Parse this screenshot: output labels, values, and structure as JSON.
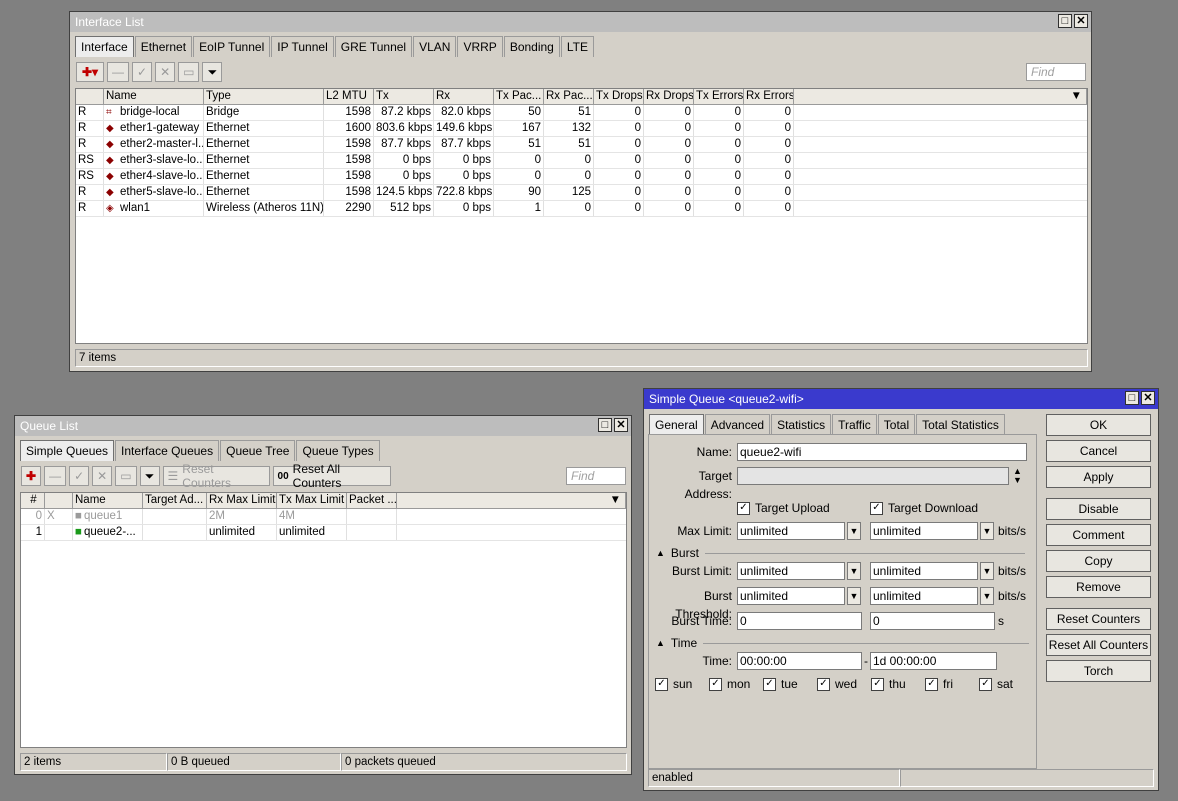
{
  "interface_list": {
    "title": "Interface List",
    "tabs": [
      "Interface",
      "Ethernet",
      "EoIP Tunnel",
      "IP Tunnel",
      "GRE Tunnel",
      "VLAN",
      "VRRP",
      "Bonding",
      "LTE"
    ],
    "find_placeholder": "Find",
    "columns": [
      "",
      "Name",
      "Type",
      "L2 MTU",
      "Tx",
      "Rx",
      "Tx Pac...",
      "Rx Pac...",
      "Tx Drops",
      "Rx Drops",
      "Tx Errors",
      "Rx Errors"
    ],
    "rows": [
      {
        "flag": "R",
        "icon": "bridge-icon",
        "name": "bridge-local",
        "type": "Bridge",
        "mtu": "1598",
        "tx": "87.2 kbps",
        "rx": "82.0 kbps",
        "txp": "50",
        "rxp": "51",
        "txd": "0",
        "rxd": "0",
        "txe": "0",
        "rxe": "0"
      },
      {
        "flag": "R",
        "icon": "ethernet-icon",
        "name": "ether1-gateway",
        "type": "Ethernet",
        "mtu": "1600",
        "tx": "803.6 kbps",
        "rx": "149.6 kbps",
        "txp": "167",
        "rxp": "132",
        "txd": "0",
        "rxd": "0",
        "txe": "0",
        "rxe": "0"
      },
      {
        "flag": "R",
        "icon": "ethernet-icon",
        "name": "ether2-master-l...",
        "type": "Ethernet",
        "mtu": "1598",
        "tx": "87.7 kbps",
        "rx": "87.7 kbps",
        "txp": "51",
        "rxp": "51",
        "txd": "0",
        "rxd": "0",
        "txe": "0",
        "rxe": "0"
      },
      {
        "flag": "RS",
        "icon": "ethernet-icon",
        "name": "ether3-slave-lo...",
        "type": "Ethernet",
        "mtu": "1598",
        "tx": "0 bps",
        "rx": "0 bps",
        "txp": "0",
        "rxp": "0",
        "txd": "0",
        "rxd": "0",
        "txe": "0",
        "rxe": "0"
      },
      {
        "flag": "RS",
        "icon": "ethernet-icon",
        "name": "ether4-slave-lo...",
        "type": "Ethernet",
        "mtu": "1598",
        "tx": "0 bps",
        "rx": "0 bps",
        "txp": "0",
        "rxp": "0",
        "txd": "0",
        "rxd": "0",
        "txe": "0",
        "rxe": "0"
      },
      {
        "flag": "R",
        "icon": "ethernet-icon",
        "name": "ether5-slave-lo...",
        "type": "Ethernet",
        "mtu": "1598",
        "tx": "124.5 kbps",
        "rx": "722.8 kbps",
        "txp": "90",
        "rxp": "125",
        "txd": "0",
        "rxd": "0",
        "txe": "0",
        "rxe": "0"
      },
      {
        "flag": "R",
        "icon": "wireless-icon",
        "name": "wlan1",
        "type": "Wireless (Atheros 11N)",
        "mtu": "2290",
        "tx": "512 bps",
        "rx": "0 bps",
        "txp": "1",
        "rxp": "0",
        "txd": "0",
        "rxd": "0",
        "txe": "0",
        "rxe": "0"
      }
    ],
    "status": "7 items"
  },
  "queue_list": {
    "title": "Queue List",
    "tabs": [
      "Simple Queues",
      "Interface Queues",
      "Queue Tree",
      "Queue Types"
    ],
    "reset_counters": "Reset Counters",
    "reset_all_counters": "Reset All Counters",
    "find_placeholder": "Find",
    "columns": [
      "#",
      "",
      "Name",
      "Target Ad...",
      "Rx Max Limit",
      "Tx Max Limit",
      "Packet ..."
    ],
    "rows": [
      {
        "num": "0",
        "flag": "X",
        "name": "queue1",
        "target": "",
        "rx": "2M",
        "tx": "4M",
        "packet": "",
        "disabled": true
      },
      {
        "num": "1",
        "flag": "",
        "name": "queue2-...",
        "target": "",
        "rx": "unlimited",
        "tx": "unlimited",
        "packet": "",
        "disabled": false
      }
    ],
    "status": [
      "2 items",
      "0 B queued",
      "0 packets queued"
    ]
  },
  "simple_queue": {
    "title": "Simple Queue <queue2-wifi>",
    "tabs": [
      "General",
      "Advanced",
      "Statistics",
      "Traffic",
      "Total",
      "Total Statistics"
    ],
    "name_label": "Name:",
    "name_value": "queue2-wifi",
    "target_label": "Target Address:",
    "target_upload": "Target Upload",
    "target_download": "Target Download",
    "max_limit_label": "Max Limit:",
    "max_limit_up": "unlimited",
    "max_limit_down": "unlimited",
    "unit_bits": "bits/s",
    "burst_section": "Burst",
    "burst_limit_label": "Burst Limit:",
    "burst_limit_up": "unlimited",
    "burst_limit_down": "unlimited",
    "burst_threshold_label": "Burst Threshold:",
    "burst_threshold_up": "unlimited",
    "burst_threshold_down": "unlimited",
    "burst_time_label": "Burst Time:",
    "burst_time_up": "0",
    "burst_time_down": "0",
    "unit_s": "s",
    "time_section": "Time",
    "time_label": "Time:",
    "time_from": "00:00:00",
    "time_sep": "-",
    "time_to": "1d 00:00:00",
    "days": [
      "sun",
      "mon",
      "tue",
      "wed",
      "thu",
      "fri",
      "sat"
    ],
    "buttons": {
      "ok": "OK",
      "cancel": "Cancel",
      "apply": "Apply",
      "disable": "Disable",
      "comment": "Comment",
      "copy": "Copy",
      "remove": "Remove",
      "reset_counters": "Reset Counters",
      "reset_all_counters": "Reset All Counters",
      "torch": "Torch"
    },
    "status": "enabled"
  }
}
